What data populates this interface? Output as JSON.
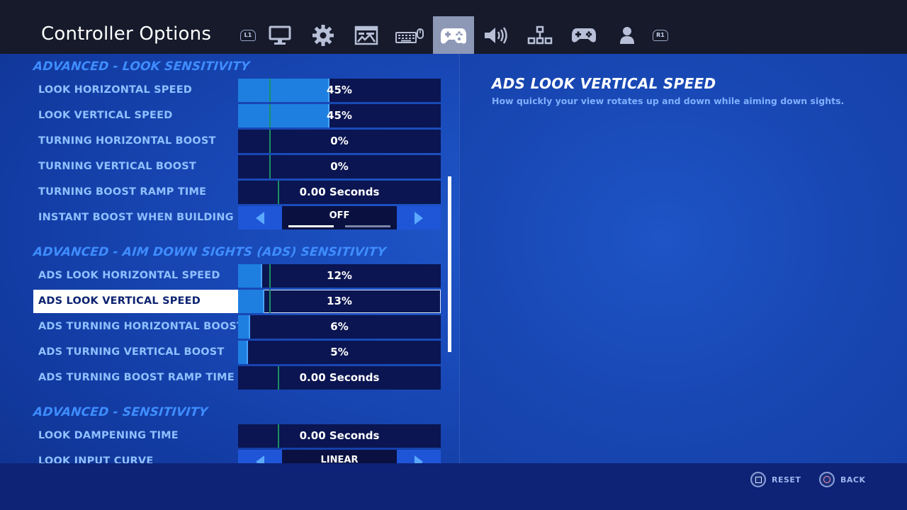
{
  "header": {
    "title": "Controller Options",
    "left_bumper": "L1",
    "right_bumper": "R1",
    "tabs": [
      {
        "icon": "monitor-icon"
      },
      {
        "icon": "gear-icon"
      },
      {
        "icon": "hud-layout-icon"
      },
      {
        "icon": "keyboard-mouse-icon"
      },
      {
        "icon": "controller-icon",
        "active": true
      },
      {
        "icon": "speaker-icon"
      },
      {
        "icon": "accessibility-icon"
      },
      {
        "icon": "gamepad-icon"
      },
      {
        "icon": "account-icon"
      }
    ]
  },
  "sections": [
    {
      "title": "ADVANCED - LOOK SENSITIVITY"
    },
    {
      "title": "ADVANCED - AIM DOWN SIGHTS (ADS) SENSITIVITY"
    },
    {
      "title": "ADVANCED - SENSITIVITY"
    }
  ],
  "settings": [
    {
      "label": "LOOK HORIZONTAL SPEED",
      "value": "45%",
      "fill_fraction": 0.45
    },
    {
      "label": "LOOK VERTICAL SPEED",
      "value": "45%",
      "fill_fraction": 0.45
    },
    {
      "label": "TURNING HORIZONTAL BOOST",
      "value": "0%",
      "fill_fraction": 0
    },
    {
      "label": "TURNING VERTICAL BOOST",
      "value": "0%",
      "fill_fraction": 0
    },
    {
      "label": "TURNING BOOST RAMP TIME",
      "value": "0.00 Seconds",
      "fill_fraction": 0
    },
    {
      "label": "INSTANT BOOST WHEN BUILDING",
      "value": "OFF"
    },
    {
      "label": "ADS LOOK HORIZONTAL SPEED",
      "value": "12%",
      "fill_fraction": 0.12
    },
    {
      "label": "ADS LOOK VERTICAL SPEED",
      "value": "13%",
      "fill_fraction": 0.13,
      "selected": true
    },
    {
      "label": "ADS TURNING HORIZONTAL BOOST",
      "value": "6%",
      "fill_fraction": 0.06
    },
    {
      "label": "ADS TURNING VERTICAL BOOST",
      "value": "5%",
      "fill_fraction": 0.05
    },
    {
      "label": "ADS TURNING BOOST RAMP TIME",
      "value": "0.00 Seconds",
      "fill_fraction": 0
    },
    {
      "label": "LOOK DAMPENING TIME",
      "value": "0.00 Seconds",
      "fill_fraction": 0
    },
    {
      "label": "LOOK INPUT CURVE",
      "value": "LINEAR"
    }
  ],
  "description": {
    "title": "ADS LOOK VERTICAL SPEED",
    "text": "How quickly your view rotates up and down while aiming down sights."
  },
  "footer": {
    "reset_label": "RESET",
    "back_label": "BACK"
  },
  "colors": {
    "accent": "#3f8dff",
    "slider_fill": "#1e7fe0",
    "default_marker": "#1c8f63",
    "active_tab": "#8d97b6"
  }
}
